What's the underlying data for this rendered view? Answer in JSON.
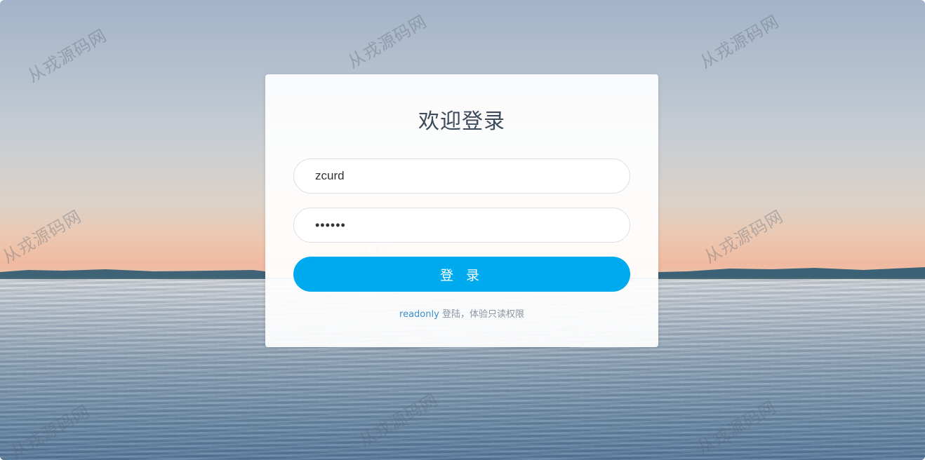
{
  "login": {
    "title": "欢迎登录",
    "username_value": "zcurd",
    "password_value": "123456",
    "submit_label": "登 录",
    "readonly_link": "readonly",
    "readonly_hint": " 登陆，体验只读权限"
  },
  "watermark": {
    "text": "从戎源码网"
  },
  "colors": {
    "accent": "#00aaee",
    "title": "#3d4a5a",
    "link": "#3a8ecf",
    "hint": "#8a96a3"
  }
}
